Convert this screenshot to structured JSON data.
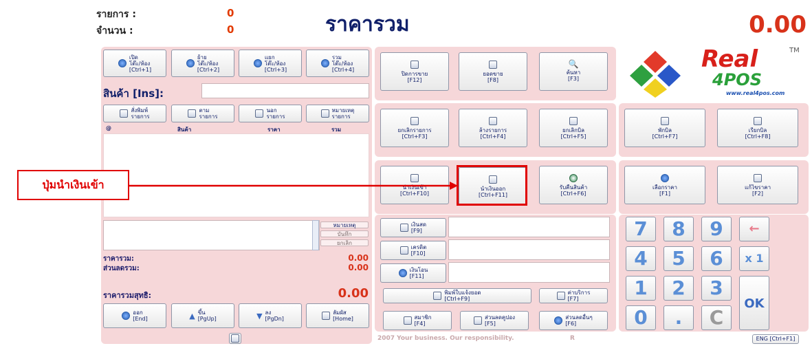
{
  "header": {
    "items_label": "รายการ :",
    "items_value": "0",
    "qty_label": "จำนวน :",
    "qty_value": "0",
    "title": "ราคารวม",
    "total": "0.00"
  },
  "left": {
    "table_buttons": [
      {
        "line1": "เปิด",
        "line2": "โต๊ะ/ห้อง",
        "key": "[Ctrl+1]"
      },
      {
        "line1": "ย้าย",
        "line2": "โต๊ะ/ห้อง",
        "key": "[Ctrl+2]"
      },
      {
        "line1": "แยก",
        "line2": "โต๊ะ/ห้อง",
        "key": "[Ctrl+3]"
      },
      {
        "line1": "รวม",
        "line2": "โต๊ะ/ห้อง",
        "key": "[Ctrl+4]"
      }
    ],
    "product_label": "สินค้า [Ins]:",
    "order_buttons": [
      {
        "line1": "สั่งพิมพ์",
        "line2": "รายการ"
      },
      {
        "line1": "ตาม",
        "line2": "รายการ"
      },
      {
        "line1": "นอก",
        "line2": "รายการ"
      },
      {
        "line1": "หมายเหตุ",
        "line2": "รายการ"
      }
    ],
    "columns": [
      "@",
      "สินค้า",
      "ราคา",
      "รวม"
    ],
    "side_buttons": [
      "หมายเหตุ",
      "บันทึก",
      "ยกเลิก"
    ],
    "summary": {
      "subtotal_label": "ราคารวม:",
      "subtotal_value": "0.00",
      "discount_label": "ส่วนลดรวม:",
      "discount_value": "0.00",
      "net_label": "ราคารวมสุทธิ:",
      "net_value": "0.00"
    },
    "nav_buttons": [
      {
        "line1": "ออก",
        "line2": "[End]"
      },
      {
        "line1": "ขึ้น",
        "line2": "[PgUp]"
      },
      {
        "line1": "ลง",
        "line2": "[PgDn]"
      },
      {
        "line1": "ลัมผัส",
        "line2": "[Home]"
      }
    ]
  },
  "middle": {
    "row1": [
      {
        "line1": "ปิดการขาย",
        "line2": "[F12]"
      },
      {
        "line1": "ยอดขาย",
        "line2": "[F8]"
      },
      {
        "line1": "ค้นหา",
        "line2": "[F3]"
      }
    ],
    "row2": [
      {
        "line1": "ยกเลิกรายการ",
        "line2": "[Ctrl+F3]"
      },
      {
        "line1": "ล้างรายการ",
        "line2": "[Ctrl+F4]"
      },
      {
        "line1": "ยกเลิกบิล",
        "line2": "[Ctrl+F5]"
      }
    ],
    "row3": [
      {
        "line1": "นำเงินเข้า",
        "line2": "[Ctrl+F10]"
      },
      {
        "line1": "นำเงินออก",
        "line2": "[Ctrl+F11]"
      },
      {
        "line1": "รับคืนสินค้า",
        "line2": "[Ctrl+F6]"
      }
    ],
    "payments": [
      {
        "line1": "เงินสด",
        "line2": "[F9]"
      },
      {
        "line1": "เครดิต",
        "line2": "[F10]"
      },
      {
        "line1": "เงินโอน",
        "line2": "[F11]"
      }
    ],
    "print_bill": {
      "line1": "พิมพ์ใบแจ้งยอด",
      "line2": "[Ctrl+F9]"
    },
    "service": {
      "line1": "ค่าบริการ",
      "line2": "[F7]"
    },
    "bottom_buttons": [
      {
        "line1": "สมาชิก",
        "line2": "[F4]"
      },
      {
        "line1": "ส่วนลดคูปอง",
        "line2": "[F5]"
      },
      {
        "line1": "ส่วนลดอื่นๆ",
        "line2": "[F6]"
      }
    ],
    "footer": "2007 Your business. Our responsibility.",
    "footer_r": "R"
  },
  "right": {
    "logo_text": "Real",
    "logo_sub": "4POS",
    "logo_tm": "TM",
    "logo_url": "www.real4pos.com",
    "hold_buttons": [
      {
        "line1": "พักบิล",
        "line2": "[Ctrl+F7]"
      },
      {
        "line1": "เรียกบิล",
        "line2": "[Ctrl+F8]"
      }
    ],
    "price_buttons": [
      {
        "line1": "เลือกราคา",
        "line2": "[F1]"
      },
      {
        "line1": "แก้ไขราคา",
        "line2": "[F2]"
      }
    ],
    "keypad": [
      "7",
      "8",
      "9",
      "←",
      "4",
      "5",
      "6",
      "x 1",
      "1",
      "2",
      "3",
      "OK",
      "0",
      ".",
      "C"
    ],
    "lang_button": "ENG [Ctrl+F1]"
  },
  "annotation": {
    "label": "ปุ่มนำเงินเข้า"
  },
  "colors": {
    "panel": "#f6d7d9",
    "title": "#11206a",
    "total": "#d8321a",
    "keypad_digit": "#5b8fd6",
    "callout": "#e00000"
  }
}
